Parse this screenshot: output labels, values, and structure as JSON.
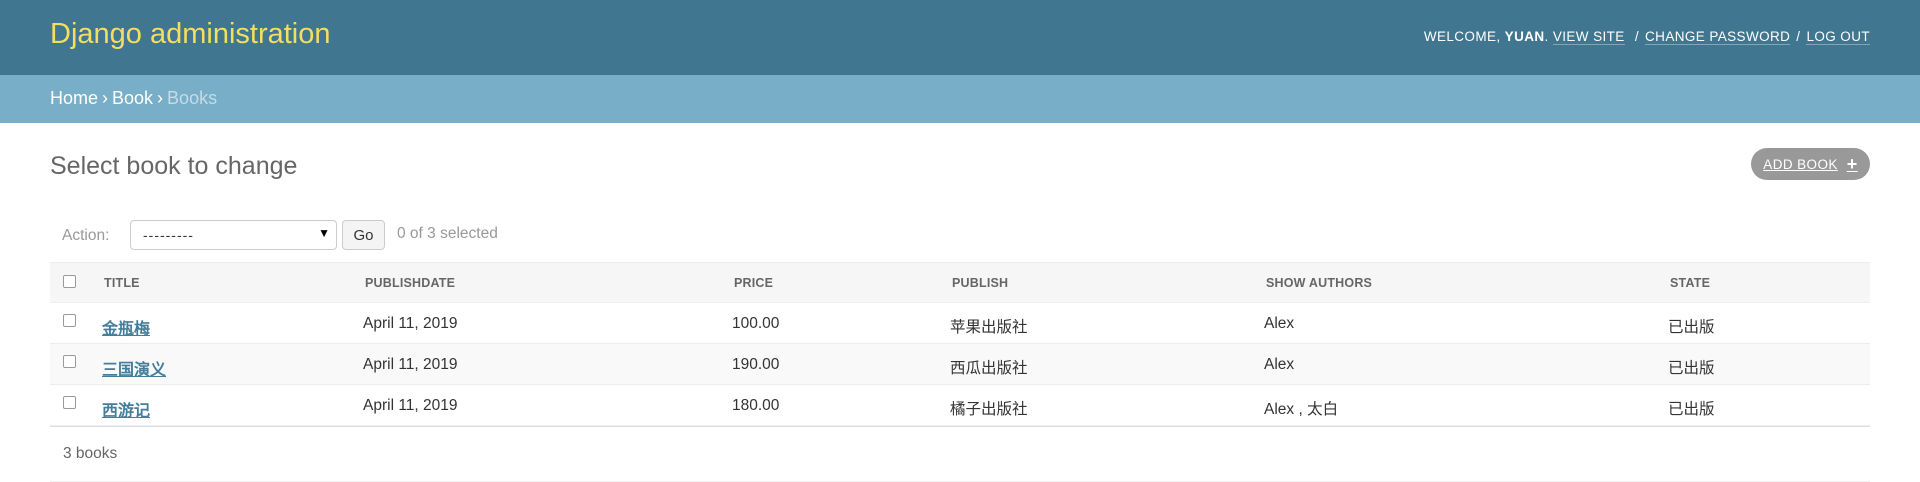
{
  "header": {
    "brand": "Django administration",
    "welcome_prefix": "WELCOME, ",
    "username": "YUAN",
    "username_suffix": ".",
    "view_site": "VIEW SITE",
    "change_password": "CHANGE PASSWORD",
    "log_out": "LOG OUT",
    "separator": "/"
  },
  "breadcrumbs": {
    "home": "Home",
    "app": "Book",
    "current": "Books",
    "arrow": "›"
  },
  "page": {
    "title": "Select book to change",
    "add_button": "ADD BOOK",
    "add_icon": "plus-icon"
  },
  "actions": {
    "label": "Action:",
    "selected_value": "---------",
    "go": "Go",
    "counter": "0 of 3 selected"
  },
  "table": {
    "columns": [
      "TITLE",
      "PUBLISHDATE",
      "PRICE",
      "PUBLISH",
      "SHOW AUTHORS",
      "STATE"
    ],
    "rows": [
      {
        "title": "金瓶梅",
        "publishdate": "April 11, 2019",
        "price": "100.00",
        "publish": "苹果出版社",
        "authors": "Alex",
        "state": "已出版"
      },
      {
        "title": "三国演义",
        "publishdate": "April 11, 2019",
        "price": "190.00",
        "publish": "西瓜出版社",
        "authors": "Alex",
        "state": "已出版"
      },
      {
        "title": "西游记",
        "publishdate": "April 11, 2019",
        "price": "180.00",
        "publish": "橘子出版社",
        "authors": "Alex , 太白",
        "state": "已出版"
      }
    ]
  },
  "paginator": {
    "count_text": "3 books"
  },
  "colors": {
    "header_bg": "#417690",
    "brand": "#f5dd5d",
    "breadcrumb_bg": "#79aec8",
    "link": "#447e9b",
    "add_button_bg": "#999999"
  }
}
